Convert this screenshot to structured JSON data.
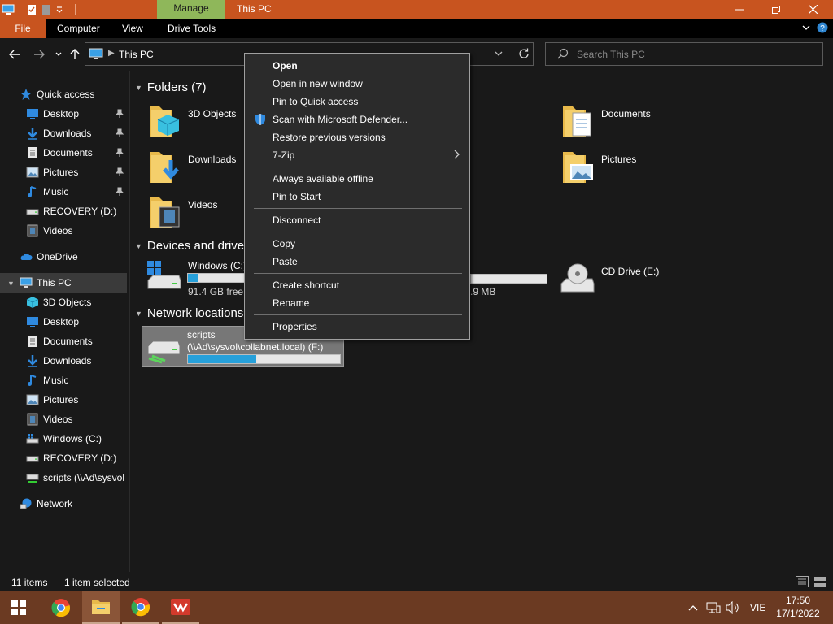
{
  "window": {
    "title": "This PC",
    "context_tab": "Manage"
  },
  "ribbon": {
    "tabs": [
      {
        "label": "File"
      },
      {
        "label": "Computer"
      },
      {
        "label": "View"
      },
      {
        "label": "Drive Tools"
      }
    ]
  },
  "address": {
    "path": "This PC"
  },
  "search": {
    "placeholder": "Search This PC"
  },
  "nav": {
    "quick_access": "Quick access",
    "quick_items": [
      {
        "label": "Desktop"
      },
      {
        "label": "Downloads"
      },
      {
        "label": "Documents"
      },
      {
        "label": "Pictures"
      },
      {
        "label": "Music"
      },
      {
        "label": "RECOVERY (D:)"
      },
      {
        "label": "Videos"
      }
    ],
    "onedrive": "OneDrive",
    "this_pc": "This PC",
    "pc_items": [
      {
        "label": "3D Objects"
      },
      {
        "label": "Desktop"
      },
      {
        "label": "Documents"
      },
      {
        "label": "Downloads"
      },
      {
        "label": "Music"
      },
      {
        "label": "Pictures"
      },
      {
        "label": "Videos"
      },
      {
        "label": "Windows (C:)"
      },
      {
        "label": "RECOVERY (D:)"
      },
      {
        "label": "scripts (\\\\Ad\\sysvol"
      }
    ],
    "network": "Network"
  },
  "content": {
    "folders_header": "Folders (7)",
    "folders": [
      {
        "label": "3D Objects"
      },
      {
        "label": "Documents"
      },
      {
        "label": "Downloads"
      },
      {
        "label": "Pictures"
      },
      {
        "label": "Videos"
      }
    ],
    "devices_header": "Devices and drives",
    "drives": [
      {
        "label": "Windows (C:)",
        "sub": "91.4 GB free o",
        "fill": 0.19
      },
      {
        "label": "",
        "sub": ".9 MB",
        "fill": 0.0
      },
      {
        "label": "CD Drive (E:)"
      }
    ],
    "network_header": "Network locations",
    "network_drive": {
      "label": "scripts",
      "sub": "(\\\\Ad\\sysvol\\collabnet.local) (F:)",
      "fill": 0.45
    }
  },
  "context_menu": {
    "items": [
      {
        "label": "Open"
      },
      {
        "label": "Open in new window"
      },
      {
        "label": "Pin to Quick access"
      },
      {
        "label": "Scan with Microsoft Defender..."
      },
      {
        "label": "Restore previous versions"
      },
      {
        "label": "7-Zip"
      },
      {
        "label": "Always available offline"
      },
      {
        "label": "Pin to Start"
      },
      {
        "label": "Disconnect"
      },
      {
        "label": "Copy"
      },
      {
        "label": "Paste"
      },
      {
        "label": "Create shortcut"
      },
      {
        "label": "Rename"
      },
      {
        "label": "Properties"
      }
    ]
  },
  "status": {
    "count": "11 items",
    "selected": "1 item selected"
  },
  "taskbar": {
    "language": "VIE",
    "time": "17:50",
    "date": "17/1/2022"
  },
  "colors": {
    "accent": "#c8541f",
    "manage_tab": "#8fb75a",
    "drive_fill": "#26a0da",
    "taskbar": "#6b3a22"
  }
}
